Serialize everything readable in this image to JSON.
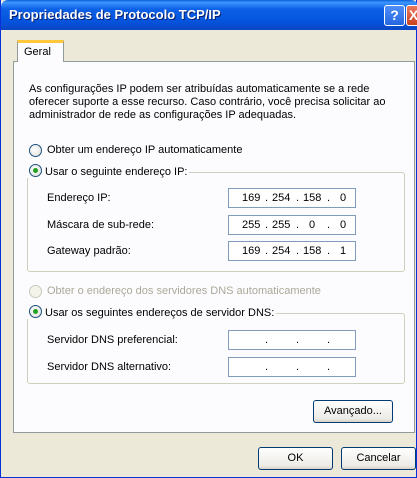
{
  "window": {
    "title": "Propriedades de Protocolo TCP/IP",
    "help_label": "?",
    "close_label": "X"
  },
  "tabs": [
    {
      "label": "Geral"
    }
  ],
  "description": "As configurações IP podem ser atribuídas automaticamente se a rede oferecer suporte a esse recurso. Caso contrário, você precisa solicitar ao administrador de rede as configurações IP adequadas.",
  "ip_section": {
    "auto_label": "Obter um endereço IP automaticamente",
    "manual_label": "Usar o seguinte endereço IP:",
    "selected": "manual",
    "fields": [
      {
        "label": "Endereço IP:",
        "octets": [
          "169",
          "254",
          "158",
          "0"
        ]
      },
      {
        "label": "Máscara de sub-rede:",
        "octets": [
          "255",
          "255",
          "0",
          "0"
        ]
      },
      {
        "label": "Gateway padrão:",
        "octets": [
          "169",
          "254",
          "158",
          "1"
        ]
      }
    ]
  },
  "dns_section": {
    "auto_label": "Obter o endereço dos servidores DNS automaticamente",
    "manual_label": "Usar os seguintes endereços de servidor DNS:",
    "selected": "manual",
    "auto_disabled": true,
    "fields": [
      {
        "label": "Servidor DNS preferencial:",
        "octets": [
          "",
          "",
          "",
          ""
        ]
      },
      {
        "label": "Servidor DNS alternativo:",
        "octets": [
          "",
          "",
          "",
          ""
        ]
      }
    ]
  },
  "buttons": {
    "advanced": "Avançado...",
    "ok": "OK",
    "cancel": "Cancelar"
  },
  "colors": {
    "titlebar": "#0554de",
    "dialog_bg": "#ece9d8",
    "tab_highlight": "#ffc83c",
    "radio_selected": "#21a121"
  }
}
